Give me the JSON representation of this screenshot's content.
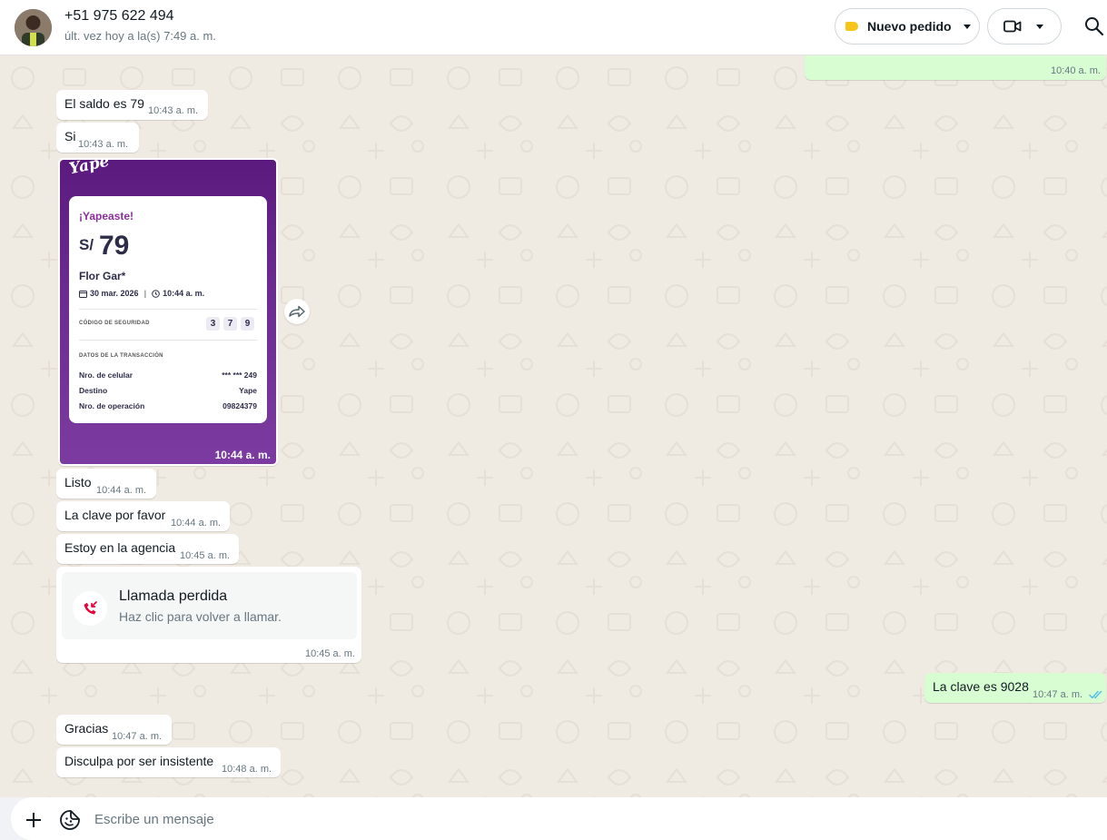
{
  "header": {
    "contact_name": "+51 975 622 494",
    "last_seen": "últ. vez hoy a la(s) 7:49 a. m.",
    "order_button_label": "Nuevo pedido",
    "label_color": "#f5c518",
    "video_icon": "video-icon",
    "search_icon": "search-icon"
  },
  "messages": [
    {
      "dir": "out",
      "text": "",
      "time": "10:40 a. m."
    },
    {
      "dir": "in",
      "text": "El saldo es 79",
      "time": "10:43 a. m."
    },
    {
      "dir": "in",
      "text": "Si",
      "time": "10:43 a. m."
    },
    {
      "dir": "in",
      "text": "Listo",
      "time": "10:44 a. m."
    },
    {
      "dir": "in",
      "text": "La clave por favor",
      "time": "10:44 a. m."
    },
    {
      "dir": "in",
      "text": "Estoy en la agencia",
      "time": "10:45 a. m."
    },
    {
      "dir": "out",
      "text": "La clave es 9028",
      "time": "10:47 a. m."
    },
    {
      "dir": "in",
      "text": "Gracias",
      "time": "10:47 a. m."
    },
    {
      "dir": "in",
      "text": "Disculpa por ser insistente",
      "time": "10:48 a. m."
    }
  ],
  "receipt": {
    "logo": "Yape",
    "title": "¡Yapeaste!",
    "currency": "S/",
    "amount": "79",
    "recipient": "Flor Gar*",
    "date": "30 mar. 2026",
    "time_label": "10:44 a. m.",
    "security_label": "CÓDIGO DE SEGURIDAD",
    "security_digits": [
      "3",
      "7",
      "9"
    ],
    "data_label": "DATOS DE LA TRANSACCIÓN",
    "rows": [
      {
        "label": "Nro. de celular",
        "value": "*** *** 249"
      },
      {
        "label": "Destino",
        "value": "Yape"
      },
      {
        "label": "Nro. de operación",
        "value": "09824379"
      }
    ],
    "image_time": "10:44 a. m."
  },
  "missed_call": {
    "title": "Llamada perdida",
    "subtitle": "Haz clic para volver a llamar.",
    "time": "10:45 a. m.",
    "icon_color": "#ea0038"
  },
  "composer": {
    "placeholder": "Escribe un mensaje"
  },
  "colors": {
    "outgoing_bubble": "#d9fdd3",
    "incoming_bubble": "#ffffff",
    "read_ticks": "#53bdeb"
  }
}
